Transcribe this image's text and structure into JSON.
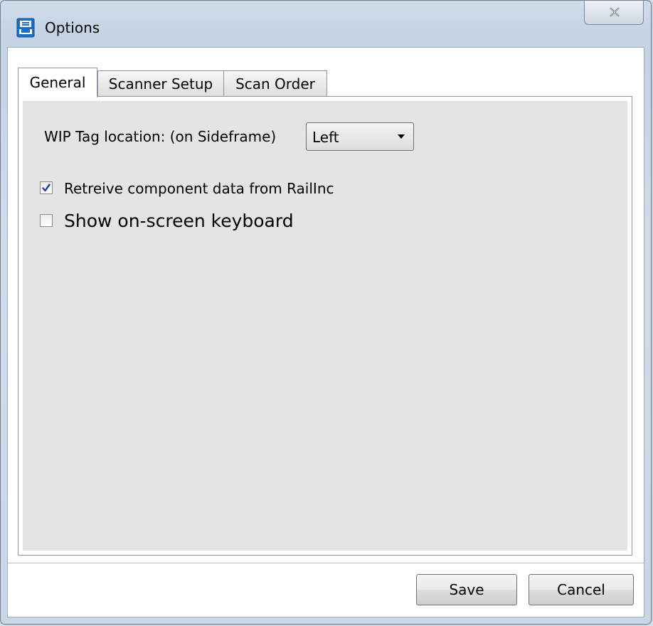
{
  "window": {
    "title": "Options"
  },
  "tabs": [
    {
      "label": "General",
      "active": true
    },
    {
      "label": "Scanner Setup",
      "active": false
    },
    {
      "label": "Scan Order",
      "active": false
    }
  ],
  "general": {
    "wip_tag_label": "WIP Tag location: (on Sideframe)",
    "wip_tag_value": "Left",
    "retrieve_label": "Retreive component data from RailInc",
    "retrieve_checked": true,
    "keyboard_label": "Show on-screen keyboard",
    "keyboard_checked": false
  },
  "buttons": {
    "save": "Save",
    "cancel": "Cancel"
  },
  "icons": {
    "app": "app-logo-icon",
    "close": "close-icon",
    "dropdown": "chevron-down-icon",
    "check": "checkmark-icon"
  },
  "colors": {
    "panel_bg": "#e4e4e4",
    "checkmark": "#2b3f8f",
    "app_icon": "#1e6fc0"
  }
}
